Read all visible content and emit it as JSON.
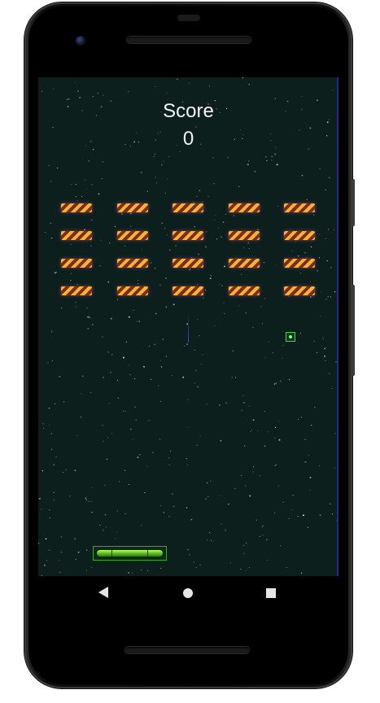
{
  "game": {
    "score_label": "Score",
    "score_value": "0",
    "brick_rows": 4,
    "brick_cols": 5,
    "colors": {
      "background": "#0d1f1c",
      "brick_stripe_light": "#f4b23c",
      "brick_stripe_dark": "#7a2e12",
      "paddle": "#5fbf22",
      "powerup": "#4bd14b",
      "ball_trail": "#3d4bd8"
    }
  },
  "navigation": {
    "back_icon": "back-triangle-icon",
    "home_icon": "home-circle-icon",
    "recents_icon": "recents-square-icon"
  }
}
